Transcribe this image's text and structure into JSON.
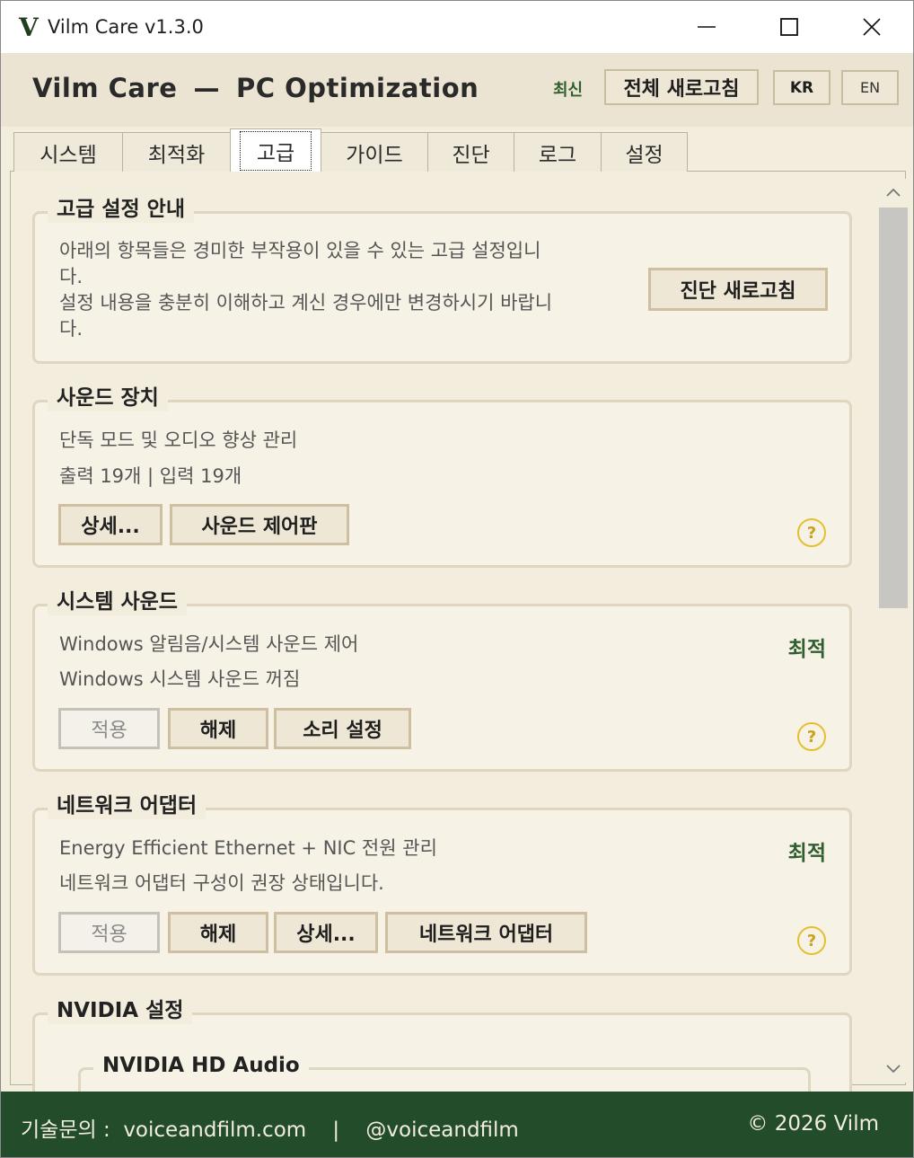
{
  "window": {
    "logo": "V",
    "title": "Vilm Care v1.3.0"
  },
  "header": {
    "app_name": "Vilm Care",
    "separator": "—",
    "subtitle": "PC Optimization",
    "latest_label": "최신",
    "refresh_all": "전체 새로고침",
    "lang_kr": "KR",
    "lang_en": "EN"
  },
  "tabs": [
    {
      "label": "시스템"
    },
    {
      "label": "최적화"
    },
    {
      "label": "고급",
      "active": true
    },
    {
      "label": "가이드"
    },
    {
      "label": "진단"
    },
    {
      "label": "로그"
    },
    {
      "label": "설정"
    }
  ],
  "advanced_notice": {
    "title": "고급 설정 안내",
    "line1": "아래의 항목들은 경미한 부작용이 있을 수 있는 고급 설정입니",
    "line1b": "다.",
    "line2": "설정 내용을 충분히 이해하고 계신 경우에만 변경하시기 바랍니",
    "line2b": "다.",
    "button": "진단 새로고침"
  },
  "sound_devices": {
    "title": "사운드 장치",
    "desc": "단독 모드 및 오디오 향상 관리",
    "counts": "출력 19개 | 입력 19개",
    "btn_details": "상세...",
    "btn_panel": "사운드 제어판",
    "help": "?"
  },
  "system_sound": {
    "title": "시스템 사운드",
    "desc": "Windows 알림음/시스템 사운드 제어",
    "status_text": "Windows 시스템 사운드 꺼짐",
    "status": "최적",
    "btn_apply": "적용",
    "btn_release": "해제",
    "btn_sound_settings": "소리 설정",
    "help": "?"
  },
  "network_adapter": {
    "title": "네트워크 어댑터",
    "desc": "Energy Efficient Ethernet + NIC 전원 관리",
    "status_text": "네트워크 어댑터 구성이 권장 상태입니다.",
    "status": "최적",
    "btn_apply": "적용",
    "btn_release": "해제",
    "btn_details": "상세...",
    "btn_adapter": "네트워크 어댑터",
    "help": "?"
  },
  "nvidia": {
    "title": "NVIDIA 설정",
    "sub_title": "NVIDIA HD Audio"
  },
  "footer": {
    "contact": "기술문의 :  voiceandfilm.com    |    @voiceandfilm",
    "copyright": "© 2026 Vilm"
  },
  "colors": {
    "accent_green": "#234d2a",
    "status_green": "#2f5e2f",
    "background": "#f3eddd",
    "help_yellow": "#e4c030"
  }
}
